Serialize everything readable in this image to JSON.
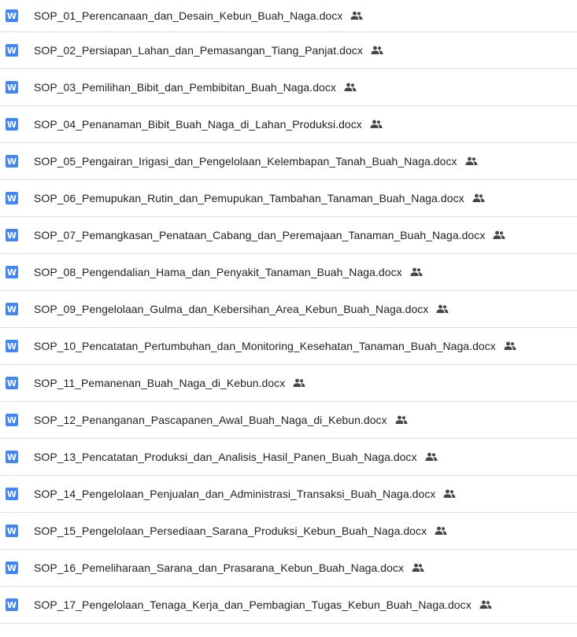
{
  "files": [
    {
      "name": "SOP_01_Perencanaan_dan_Desain_Kebun_Buah_Naga.docx",
      "type_icon": "word-doc-icon",
      "shared_icon": "shared-people-icon"
    },
    {
      "name": "SOP_02_Persiapan_Lahan_dan_Pemasangan_Tiang_Panjat.docx",
      "type_icon": "word-doc-icon",
      "shared_icon": "shared-people-icon"
    },
    {
      "name": "SOP_03_Pemilihan_Bibit_dan_Pembibitan_Buah_Naga.docx",
      "type_icon": "word-doc-icon",
      "shared_icon": "shared-people-icon"
    },
    {
      "name": "SOP_04_Penanaman_Bibit_Buah_Naga_di_Lahan_Produksi.docx",
      "type_icon": "word-doc-icon",
      "shared_icon": "shared-people-icon"
    },
    {
      "name": "SOP_05_Pengairan_Irigasi_dan_Pengelolaan_Kelembapan_Tanah_Buah_Naga.docx",
      "type_icon": "word-doc-icon",
      "shared_icon": "shared-people-icon"
    },
    {
      "name": "SOP_06_Pemupukan_Rutin_dan_Pemupukan_Tambahan_Tanaman_Buah_Naga.docx",
      "type_icon": "word-doc-icon",
      "shared_icon": "shared-people-icon"
    },
    {
      "name": "SOP_07_Pemangkasan_Penataan_Cabang_dan_Peremajaan_Tanaman_Buah_Naga.docx",
      "type_icon": "word-doc-icon",
      "shared_icon": "shared-people-icon"
    },
    {
      "name": "SOP_08_Pengendalian_Hama_dan_Penyakit_Tanaman_Buah_Naga.docx",
      "type_icon": "word-doc-icon",
      "shared_icon": "shared-people-icon"
    },
    {
      "name": "SOP_09_Pengelolaan_Gulma_dan_Kebersihan_Area_Kebun_Buah_Naga.docx",
      "type_icon": "word-doc-icon",
      "shared_icon": "shared-people-icon"
    },
    {
      "name": "SOP_10_Pencatatan_Pertumbuhan_dan_Monitoring_Kesehatan_Tanaman_Buah_Naga.docx",
      "type_icon": "word-doc-icon",
      "shared_icon": "shared-people-icon"
    },
    {
      "name": "SOP_11_Pemanenan_Buah_Naga_di_Kebun.docx",
      "type_icon": "word-doc-icon",
      "shared_icon": "shared-people-icon"
    },
    {
      "name": "SOP_12_Penanganan_Pascapanen_Awal_Buah_Naga_di_Kebun.docx",
      "type_icon": "word-doc-icon",
      "shared_icon": "shared-people-icon"
    },
    {
      "name": "SOP_13_Pencatatan_Produksi_dan_Analisis_Hasil_Panen_Buah_Naga.docx",
      "type_icon": "word-doc-icon",
      "shared_icon": "shared-people-icon"
    },
    {
      "name": "SOP_14_Pengelolaan_Penjualan_dan_Administrasi_Transaksi_Buah_Naga.docx",
      "type_icon": "word-doc-icon",
      "shared_icon": "shared-people-icon"
    },
    {
      "name": "SOP_15_Pengelolaan_Persediaan_Sarana_Produksi_Kebun_Buah_Naga.docx",
      "type_icon": "word-doc-icon",
      "shared_icon": "shared-people-icon"
    },
    {
      "name": "SOP_16_Pemeliharaan_Sarana_dan_Prasarana_Kebun_Buah_Naga.docx",
      "type_icon": "word-doc-icon",
      "shared_icon": "shared-people-icon"
    },
    {
      "name": "SOP_17_Pengelolaan_Tenaga_Kerja_dan_Pembagian_Tugas_Kebun_Buah_Naga.docx",
      "type_icon": "word-doc-icon",
      "shared_icon": "shared-people-icon"
    }
  ],
  "icon_letter": "W",
  "colors": {
    "word_icon": "#4285f4",
    "shared_icon": "#444746",
    "divider": "#e0e0e0",
    "text": "#1f1f1f"
  }
}
